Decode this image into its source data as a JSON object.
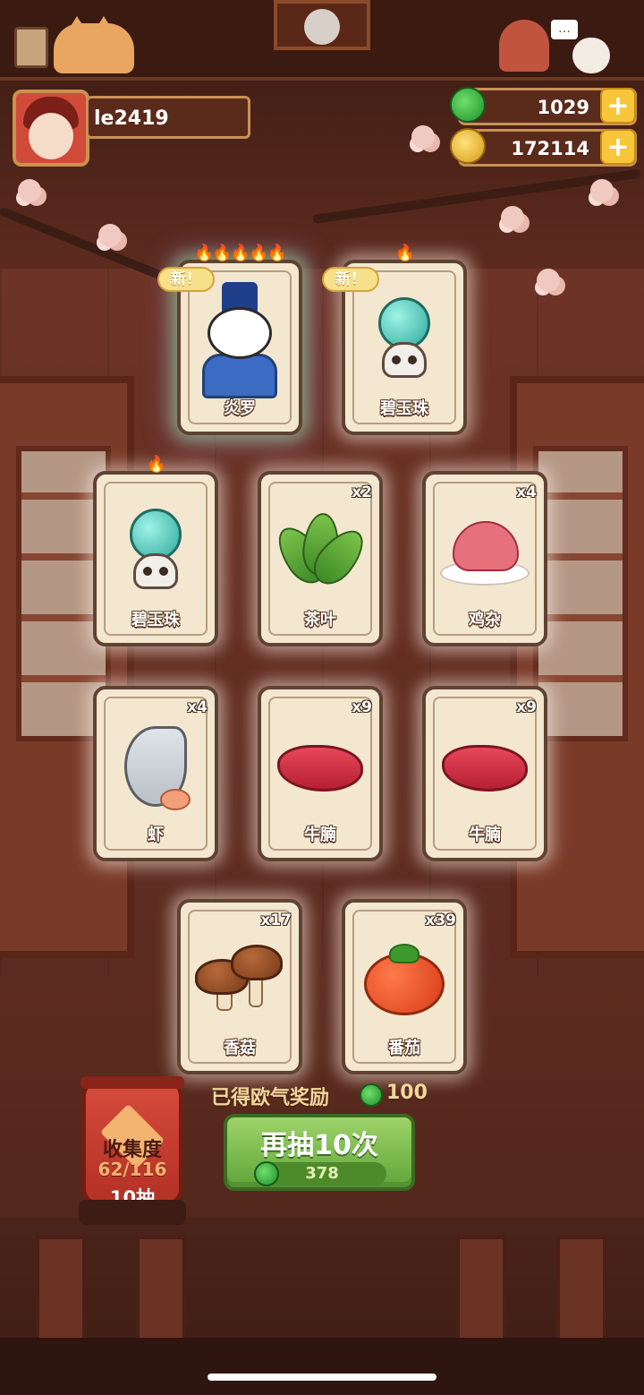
{
  "player": {
    "name": "le2419"
  },
  "currency": {
    "jade": {
      "value": "1029",
      "plus": "+"
    },
    "gold": {
      "value": "172114",
      "plus": "+"
    }
  },
  "topbar": {
    "chat": "…"
  },
  "cards": [
    {
      "name": "炎罗",
      "count": "",
      "new_label": "新！",
      "flames": "🔥🔥🔥🔥🔥"
    },
    {
      "name": "碧玉珠",
      "count": "",
      "new_label": "新！",
      "flames": "🔥"
    },
    {
      "name": "碧玉珠",
      "count": "",
      "new_label": "",
      "flames": "🔥"
    },
    {
      "name": "茶叶",
      "count": "x2",
      "new_label": "",
      "flames": ""
    },
    {
      "name": "鸡杂",
      "count": "x4",
      "new_label": "",
      "flames": ""
    },
    {
      "name": "虾",
      "count": "x4",
      "new_label": "",
      "flames": ""
    },
    {
      "name": "牛腩",
      "count": "x9",
      "new_label": "",
      "flames": ""
    },
    {
      "name": "牛腩",
      "count": "x9",
      "new_label": "",
      "flames": ""
    },
    {
      "name": "香菇",
      "count": "x17",
      "new_label": "",
      "flames": ""
    },
    {
      "name": "番茄",
      "count": "x39",
      "new_label": "",
      "flames": ""
    }
  ],
  "collection": {
    "label": "收集度",
    "count": "62/116",
    "draws": "10抽"
  },
  "reward": {
    "label": "已得欧气奖励",
    "value": "100"
  },
  "draw_button": {
    "label": "再抽10次",
    "cost": "378"
  },
  "colors": {
    "accent_green": "#5fa53a",
    "gold": "#f7c63b",
    "wood": "#5a2a1b"
  },
  "icons": [
    "book-icon",
    "cat-icon",
    "chat-icon",
    "jade-icon",
    "gold-coin-icon",
    "plus-icon",
    "flame-icon"
  ]
}
